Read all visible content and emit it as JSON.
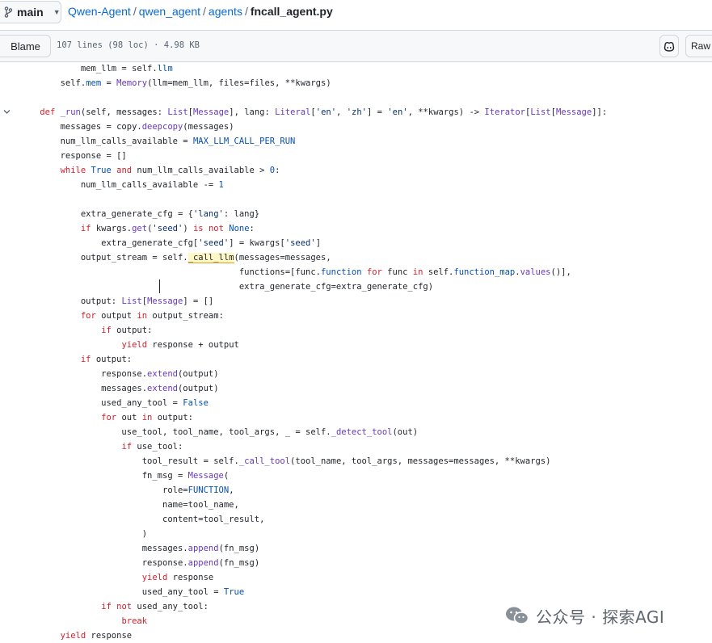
{
  "branch": {
    "name": "main"
  },
  "breadcrumb": {
    "repo": "Qwen-Agent",
    "dir1": "qwen_agent",
    "dir2": "agents",
    "file": "fncall_agent.py",
    "sep": "/"
  },
  "toolbar": {
    "blame_label": "Blame",
    "file_info": "107 lines (98 loc) · 4.98 KB",
    "raw_label": "Raw"
  },
  "watermark": {
    "text": "公众号 · 探索AGI"
  },
  "code_lines": [
    [
      {
        "t": "            mem_llm = self."
      },
      {
        "t": "llm",
        "c": "c"
      }
    ],
    [
      {
        "t": "        self."
      },
      {
        "t": "mem",
        "c": "c"
      },
      {
        "t": " = "
      },
      {
        "t": "Memory",
        "c": "fn"
      },
      {
        "t": "(llm=mem_llm, files=files, **kwargs)"
      }
    ],
    [
      {
        "t": ""
      }
    ],
    [
      {
        "t": "    "
      },
      {
        "t": "def",
        "c": "kw"
      },
      {
        "t": " "
      },
      {
        "t": "_run",
        "c": "fn"
      },
      {
        "t": "(self, messages: "
      },
      {
        "t": "List",
        "c": "fn"
      },
      {
        "t": "["
      },
      {
        "t": "Message",
        "c": "fn"
      },
      {
        "t": "], lang: "
      },
      {
        "t": "Literal",
        "c": "fn"
      },
      {
        "t": "["
      },
      {
        "t": "'en'",
        "c": "str"
      },
      {
        "t": ", "
      },
      {
        "t": "'zh'",
        "c": "str"
      },
      {
        "t": "] = "
      },
      {
        "t": "'en'",
        "c": "str"
      },
      {
        "t": ", **kwargs) -> "
      },
      {
        "t": "Iterator",
        "c": "fn"
      },
      {
        "t": "["
      },
      {
        "t": "List",
        "c": "fn"
      },
      {
        "t": "["
      },
      {
        "t": "Message",
        "c": "fn"
      },
      {
        "t": "]]:"
      }
    ],
    [
      {
        "t": "        messages = copy."
      },
      {
        "t": "deepcopy",
        "c": "fn"
      },
      {
        "t": "(messages)"
      }
    ],
    [
      {
        "t": "        num_llm_calls_available = "
      },
      {
        "t": "MAX_LLM_CALL_PER_RUN",
        "c": "c"
      }
    ],
    [
      {
        "t": "        response = []"
      }
    ],
    [
      {
        "t": "        "
      },
      {
        "t": "while",
        "c": "kw"
      },
      {
        "t": " "
      },
      {
        "t": "True",
        "c": "c"
      },
      {
        "t": " "
      },
      {
        "t": "and",
        "c": "kw"
      },
      {
        "t": " num_llm_calls_available > "
      },
      {
        "t": "0",
        "c": "c"
      },
      {
        "t": ":"
      }
    ],
    [
      {
        "t": "            num_llm_calls_available -= "
      },
      {
        "t": "1",
        "c": "c"
      }
    ],
    [
      {
        "t": ""
      }
    ],
    [
      {
        "t": "            extra_generate_cfg = {"
      },
      {
        "t": "'lang'",
        "c": "str"
      },
      {
        "t": ": lang}"
      }
    ],
    [
      {
        "t": "            "
      },
      {
        "t": "if",
        "c": "kw"
      },
      {
        "t": " kwargs."
      },
      {
        "t": "get",
        "c": "fn"
      },
      {
        "t": "("
      },
      {
        "t": "'seed'",
        "c": "str"
      },
      {
        "t": ") "
      },
      {
        "t": "is not",
        "c": "kw"
      },
      {
        "t": " "
      },
      {
        "t": "None",
        "c": "c"
      },
      {
        "t": ":"
      }
    ],
    [
      {
        "t": "                extra_generate_cfg["
      },
      {
        "t": "'seed'",
        "c": "str"
      },
      {
        "t": "] = kwargs["
      },
      {
        "t": "'seed'",
        "c": "str"
      },
      {
        "t": "]"
      }
    ],
    [
      {
        "t": "            output_stream = self."
      },
      {
        "t": "_call_llm",
        "c": "hl"
      },
      {
        "t": "(messages=messages,"
      }
    ],
    [
      {
        "t": "                                           functions=[func."
      },
      {
        "t": "function",
        "c": "c"
      },
      {
        "t": " "
      },
      {
        "t": "for",
        "c": "kw"
      },
      {
        "t": " func "
      },
      {
        "t": "in",
        "c": "kw"
      },
      {
        "t": " self."
      },
      {
        "t": "function_map",
        "c": "c"
      },
      {
        "t": "."
      },
      {
        "t": "values",
        "c": "fn"
      },
      {
        "t": "()],"
      }
    ],
    [
      {
        "t": "                                           extra_generate_cfg=extra_generate_cfg)"
      }
    ],
    [
      {
        "t": "            output: "
      },
      {
        "t": "List",
        "c": "fn"
      },
      {
        "t": "["
      },
      {
        "t": "Message",
        "c": "fn"
      },
      {
        "t": "] = []"
      }
    ],
    [
      {
        "t": "            "
      },
      {
        "t": "for",
        "c": "kw"
      },
      {
        "t": " output "
      },
      {
        "t": "in",
        "c": "kw"
      },
      {
        "t": " output_stream:"
      }
    ],
    [
      {
        "t": "                "
      },
      {
        "t": "if",
        "c": "kw"
      },
      {
        "t": " output:"
      }
    ],
    [
      {
        "t": "                    "
      },
      {
        "t": "yield",
        "c": "kw"
      },
      {
        "t": " response + output"
      }
    ],
    [
      {
        "t": "            "
      },
      {
        "t": "if",
        "c": "kw"
      },
      {
        "t": " output:"
      }
    ],
    [
      {
        "t": "                response."
      },
      {
        "t": "extend",
        "c": "fn"
      },
      {
        "t": "(output)"
      }
    ],
    [
      {
        "t": "                messages."
      },
      {
        "t": "extend",
        "c": "fn"
      },
      {
        "t": "(output)"
      }
    ],
    [
      {
        "t": "                used_any_tool = "
      },
      {
        "t": "False",
        "c": "c"
      }
    ],
    [
      {
        "t": "                "
      },
      {
        "t": "for",
        "c": "kw"
      },
      {
        "t": " out "
      },
      {
        "t": "in",
        "c": "kw"
      },
      {
        "t": " output:"
      }
    ],
    [
      {
        "t": "                    use_tool, tool_name, tool_args, _ = self."
      },
      {
        "t": "_detect_tool",
        "c": "fn"
      },
      {
        "t": "(out)"
      }
    ],
    [
      {
        "t": "                    "
      },
      {
        "t": "if",
        "c": "kw"
      },
      {
        "t": " use_tool:"
      }
    ],
    [
      {
        "t": "                        tool_result = self."
      },
      {
        "t": "_call_tool",
        "c": "fn"
      },
      {
        "t": "(tool_name, tool_args, messages=messages, **kwargs)"
      }
    ],
    [
      {
        "t": "                        fn_msg = "
      },
      {
        "t": "Message",
        "c": "fn"
      },
      {
        "t": "("
      }
    ],
    [
      {
        "t": "                            role="
      },
      {
        "t": "FUNCTION",
        "c": "c"
      },
      {
        "t": ","
      }
    ],
    [
      {
        "t": "                            name=tool_name,"
      }
    ],
    [
      {
        "t": "                            content=tool_result,"
      }
    ],
    [
      {
        "t": "                        )"
      }
    ],
    [
      {
        "t": "                        messages."
      },
      {
        "t": "append",
        "c": "fn"
      },
      {
        "t": "(fn_msg)"
      }
    ],
    [
      {
        "t": "                        response."
      },
      {
        "t": "append",
        "c": "fn"
      },
      {
        "t": "(fn_msg)"
      }
    ],
    [
      {
        "t": "                        "
      },
      {
        "t": "yield",
        "c": "kw"
      },
      {
        "t": " response"
      }
    ],
    [
      {
        "t": "                        used_any_tool = "
      },
      {
        "t": "True",
        "c": "c"
      }
    ],
    [
      {
        "t": "                "
      },
      {
        "t": "if not",
        "c": "kw"
      },
      {
        "t": " used_any_tool:"
      }
    ],
    [
      {
        "t": "                    "
      },
      {
        "t": "break",
        "c": "kw"
      }
    ],
    [
      {
        "t": "        "
      },
      {
        "t": "yield",
        "c": "kw"
      },
      {
        "t": " response"
      }
    ]
  ]
}
